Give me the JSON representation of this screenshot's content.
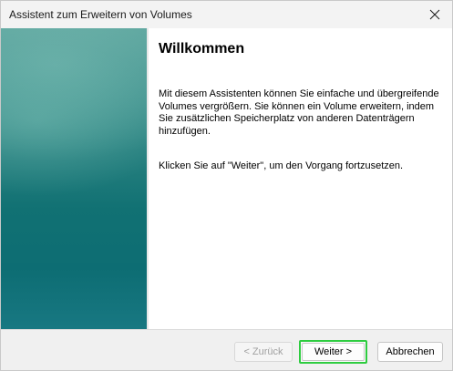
{
  "window": {
    "title": "Assistent zum Erweitern von Volumes",
    "close_icon": "close-icon"
  },
  "content": {
    "heading": "Willkommen",
    "paragraph1": "Mit diesem Assistenten können Sie einfache und übergreifende Volumes vergrößern. Sie können ein Volume erweitern, indem Sie zusätzlichen Speicherplatz von anderen Datenträgern hinzufügen.",
    "paragraph2": "Klicken Sie auf \"Weiter\", um den Vorgang fortzusetzen."
  },
  "buttons": {
    "back": "< Zurück",
    "next": "Weiter >",
    "cancel": "Abbrechen"
  },
  "colors": {
    "banner_teal": "#117173",
    "highlight_green": "#2ecc40"
  }
}
